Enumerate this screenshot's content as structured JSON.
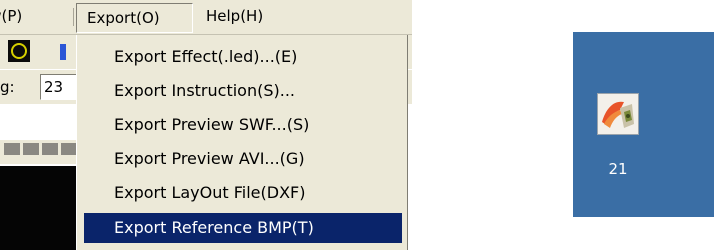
{
  "menubar": {
    "items": [
      {
        "label": "ew(P)"
      },
      {
        "label": "Export(O)"
      },
      {
        "label": "Help(H)"
      }
    ]
  },
  "toolbar_field": {
    "label": "g:",
    "value": "23"
  },
  "export_menu": {
    "items": [
      {
        "label": "Export Effect(.led)...(E)",
        "selected": false
      },
      {
        "label": "Export Instruction(S)...",
        "selected": false
      },
      {
        "label": "Export Preview SWF...(S)",
        "selected": false
      },
      {
        "label": "Export Preview AVI...(G)",
        "selected": false
      },
      {
        "label": "Export LayOut File(DXF)",
        "selected": false
      },
      {
        "label": "Export Reference BMP(T)",
        "selected": true
      }
    ]
  },
  "desktop_icon": {
    "label": "21",
    "icon": "image-file-icon"
  },
  "colors": {
    "menu_bg": "#ece9d8",
    "selection_bg": "#0a246a",
    "desktop_bg": "#3a6ea5"
  }
}
